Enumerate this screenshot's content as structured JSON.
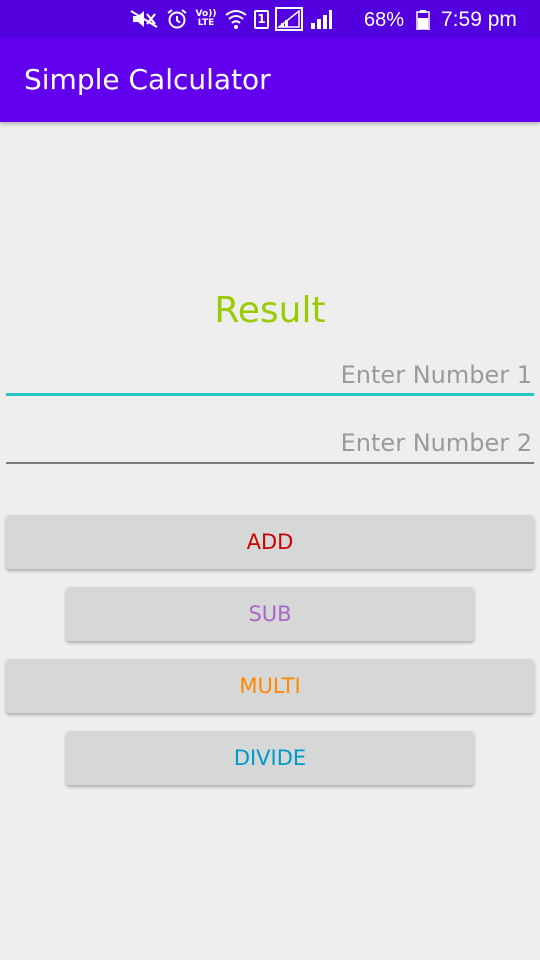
{
  "status_bar": {
    "battery": "68%",
    "time": "7:59 pm",
    "volte_line1": "Vo))",
    "volte_line2": "LTE",
    "sim_number": "1",
    "icons": [
      "mute-icon",
      "alarm-icon",
      "volte-icon",
      "wifi-icon",
      "sim-icon",
      "signal-icon",
      "signal-icon",
      "battery-icon"
    ],
    "background": "#5200e0"
  },
  "app_bar": {
    "title": "Simple Calculator",
    "background": "#6200ee"
  },
  "main": {
    "result_label": "Result",
    "result_color": "#99cc00",
    "input1": {
      "placeholder": "Enter Number 1",
      "value": ""
    },
    "input2": {
      "placeholder": "Enter Number 2",
      "value": ""
    },
    "buttons": [
      {
        "label": "ADD",
        "color": "#cc0000"
      },
      {
        "label": "SUB",
        "color": "#aa66cc"
      },
      {
        "label": "MULTI",
        "color": "#ff8800"
      },
      {
        "label": "DIVIDE",
        "color": "#0099cc"
      }
    ]
  }
}
